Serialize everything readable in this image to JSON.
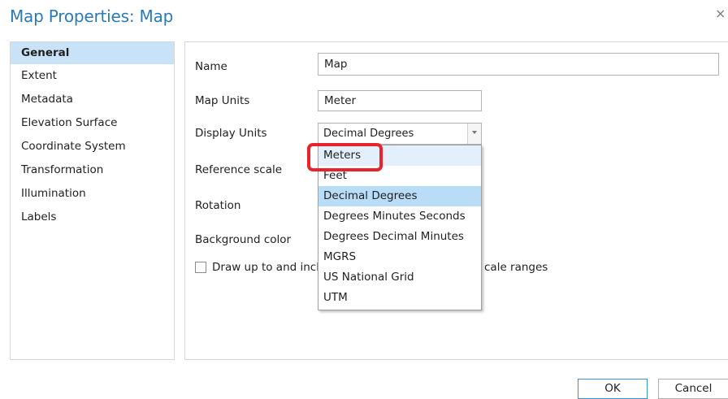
{
  "window": {
    "title": "Map Properties: Map",
    "close_glyph": "×"
  },
  "sidebar": {
    "items": [
      {
        "label": "General",
        "selected": true
      },
      {
        "label": "Extent"
      },
      {
        "label": "Metadata"
      },
      {
        "label": "Elevation Surface"
      },
      {
        "label": "Coordinate System"
      },
      {
        "label": "Transformation"
      },
      {
        "label": "Illumination"
      },
      {
        "label": "Labels"
      }
    ]
  },
  "general": {
    "name_label": "Name",
    "name_value": "Map",
    "map_units_label": "Map Units",
    "map_units_value": "Meter",
    "display_units_label": "Display Units",
    "display_units_value": "Decimal Degrees",
    "reference_scale_label": "Reference scale",
    "rotation_label": "Rotation",
    "background_color_label": "Background color",
    "checkbox_label_visible_start": "Draw up to and incl",
    "checkbox_label_visible_end": "cale ranges",
    "checkbox_checked": false
  },
  "display_units_dropdown": {
    "options": [
      {
        "label": "Meters",
        "state": "hovered"
      },
      {
        "label": "Feet"
      },
      {
        "label": "Decimal Degrees",
        "state": "selected"
      },
      {
        "label": "Degrees Minutes Seconds"
      },
      {
        "label": "Degrees Decimal Minutes"
      },
      {
        "label": "MGRS"
      },
      {
        "label": "US National Grid"
      },
      {
        "label": "UTM"
      }
    ],
    "annotation_color": "#e8232c"
  },
  "footer": {
    "ok_label": "OK",
    "cancel_label": "Cancel"
  },
  "colors": {
    "title": "#2a7ab8",
    "selected_nav": "#c8e3f8",
    "selected_option": "#b9dcf7",
    "hovered_option": "#e3f0fb",
    "highlight": "#e8232c"
  }
}
